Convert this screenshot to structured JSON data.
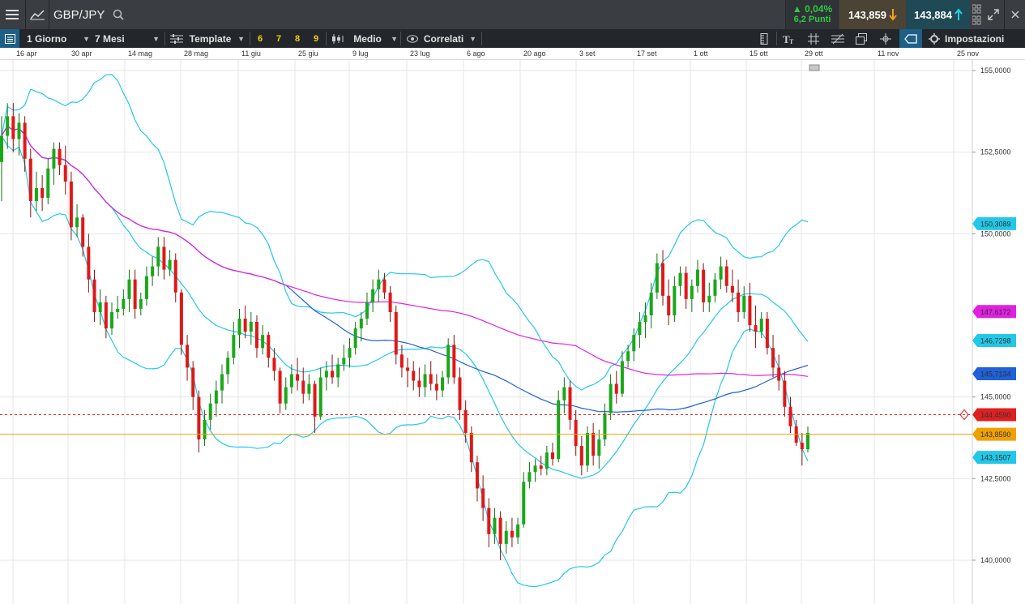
{
  "header": {
    "menu_icon": "hamburger-icon",
    "chart_icon": "line-chart-icon",
    "symbol": "GBP/JPY",
    "search_icon": "search-icon",
    "change_pct": "▲ 0,04%",
    "change_points": "6,2 Punti",
    "sell_price": "143,859",
    "buy_price": "143,884",
    "colors": {
      "up": "#2ecc40",
      "sell_bg": "#4b4333",
      "buy_bg": "#1f4a55",
      "arrow_sell": "#f0a020",
      "arrow_buy": "#28c8e8"
    }
  },
  "toolbar": {
    "interval": "1 Giorno",
    "range": "7 Mesi",
    "template": "Template",
    "presets": [
      "6",
      "7",
      "8",
      "9"
    ],
    "style": "Medio",
    "correlated": "Correlati",
    "settings": "Impostazioni"
  },
  "dates": [
    "16 apr",
    "30 apr",
    "14 mag",
    "28 mag",
    "11 giu",
    "25 giu",
    "9 lug",
    "23 lug",
    "6 ago",
    "20 ago",
    "3 set",
    "17 set",
    "1 ott",
    "15 ott",
    "29 ott",
    "11 nov",
    "25 nov"
  ],
  "chart_data": {
    "type": "candlestick",
    "symbol": "GBP/JPY",
    "y_ticks": [
      "155,0000",
      "152,5000",
      "150,0000",
      "145,0000",
      "142,5000",
      "140,0000"
    ],
    "ylim": [
      139.2,
      155.4
    ],
    "price_labels": [
      {
        "value": "150,3089",
        "series": "bollinger_upper",
        "color": "#22c8e8"
      },
      {
        "value": "147,6172",
        "series": "ma_long",
        "color": "#e020e0"
      },
      {
        "value": "146,7298",
        "series": "bollinger_mid_fast",
        "color": "#22c8e8"
      },
      {
        "value": "145,7134",
        "series": "ma_mid",
        "color": "#2060d8"
      },
      {
        "value": "144,4590",
        "series": "alert_line",
        "color": "#e02020"
      },
      {
        "value": "143,8590",
        "series": "last_price",
        "color": "#f0a000"
      },
      {
        "value": "143,1507",
        "series": "bollinger_lower",
        "color": "#22c8e8"
      }
    ],
    "candles": [
      {
        "o": 152.2,
        "h": 153.6,
        "l": 151.0,
        "c": 153.0
      },
      {
        "o": 153.0,
        "h": 154.0,
        "l": 152.6,
        "c": 153.6
      },
      {
        "o": 153.6,
        "h": 154.0,
        "l": 152.5,
        "c": 152.9
      },
      {
        "o": 152.9,
        "h": 153.7,
        "l": 152.4,
        "c": 153.4
      },
      {
        "o": 153.4,
        "h": 153.6,
        "l": 151.9,
        "c": 152.3
      },
      {
        "o": 152.3,
        "h": 152.6,
        "l": 150.5,
        "c": 151.0
      },
      {
        "o": 151.0,
        "h": 151.9,
        "l": 150.7,
        "c": 151.4
      },
      {
        "o": 151.4,
        "h": 151.8,
        "l": 150.7,
        "c": 151.1
      },
      {
        "o": 151.1,
        "h": 152.3,
        "l": 150.9,
        "c": 152.0
      },
      {
        "o": 152.0,
        "h": 152.8,
        "l": 151.5,
        "c": 152.6
      },
      {
        "o": 152.6,
        "h": 152.8,
        "l": 151.8,
        "c": 152.1
      },
      {
        "o": 152.1,
        "h": 152.7,
        "l": 151.2,
        "c": 151.6
      },
      {
        "o": 151.6,
        "h": 151.9,
        "l": 149.8,
        "c": 150.2
      },
      {
        "o": 150.2,
        "h": 150.9,
        "l": 149.9,
        "c": 150.5
      },
      {
        "o": 150.5,
        "h": 150.6,
        "l": 149.3,
        "c": 149.6
      },
      {
        "o": 149.6,
        "h": 150.0,
        "l": 148.2,
        "c": 148.6
      },
      {
        "o": 148.6,
        "h": 148.9,
        "l": 147.3,
        "c": 147.6
      },
      {
        "o": 147.6,
        "h": 148.3,
        "l": 147.2,
        "c": 147.9
      },
      {
        "o": 147.9,
        "h": 148.1,
        "l": 146.8,
        "c": 147.1
      },
      {
        "o": 147.1,
        "h": 147.9,
        "l": 146.9,
        "c": 147.6
      },
      {
        "o": 147.6,
        "h": 148.1,
        "l": 147.4,
        "c": 147.7
      },
      {
        "o": 147.7,
        "h": 148.3,
        "l": 147.5,
        "c": 148.0
      },
      {
        "o": 148.0,
        "h": 148.9,
        "l": 147.6,
        "c": 148.6
      },
      {
        "o": 148.6,
        "h": 148.9,
        "l": 147.4,
        "c": 147.7
      },
      {
        "o": 147.7,
        "h": 148.2,
        "l": 147.5,
        "c": 148.0
      },
      {
        "o": 148.0,
        "h": 149.0,
        "l": 147.8,
        "c": 148.7
      },
      {
        "o": 148.7,
        "h": 149.3,
        "l": 148.4,
        "c": 149.0
      },
      {
        "o": 149.0,
        "h": 149.9,
        "l": 148.7,
        "c": 149.6
      },
      {
        "o": 149.6,
        "h": 149.9,
        "l": 148.6,
        "c": 148.9
      },
      {
        "o": 148.9,
        "h": 149.5,
        "l": 148.7,
        "c": 149.2
      },
      {
        "o": 149.2,
        "h": 149.4,
        "l": 147.9,
        "c": 148.2
      },
      {
        "o": 148.2,
        "h": 148.3,
        "l": 146.3,
        "c": 146.6
      },
      {
        "o": 146.6,
        "h": 146.9,
        "l": 145.5,
        "c": 145.9
      },
      {
        "o": 145.9,
        "h": 146.1,
        "l": 144.6,
        "c": 145.0
      },
      {
        "o": 145.0,
        "h": 145.2,
        "l": 143.3,
        "c": 143.7
      },
      {
        "o": 143.7,
        "h": 144.6,
        "l": 143.5,
        "c": 144.3
      },
      {
        "o": 144.3,
        "h": 145.1,
        "l": 144.0,
        "c": 144.8
      },
      {
        "o": 144.8,
        "h": 145.5,
        "l": 144.4,
        "c": 145.2
      },
      {
        "o": 145.2,
        "h": 146.0,
        "l": 144.8,
        "c": 145.7
      },
      {
        "o": 145.7,
        "h": 146.4,
        "l": 145.4,
        "c": 146.2
      },
      {
        "o": 146.2,
        "h": 147.3,
        "l": 146.0,
        "c": 146.9
      },
      {
        "o": 146.9,
        "h": 147.7,
        "l": 146.5,
        "c": 147.4
      },
      {
        "o": 147.4,
        "h": 147.8,
        "l": 146.8,
        "c": 147.0
      },
      {
        "o": 147.0,
        "h": 147.6,
        "l": 146.6,
        "c": 147.3
      },
      {
        "o": 147.3,
        "h": 147.5,
        "l": 146.2,
        "c": 146.5
      },
      {
        "o": 146.5,
        "h": 147.2,
        "l": 146.3,
        "c": 146.9
      },
      {
        "o": 146.9,
        "h": 147.0,
        "l": 145.9,
        "c": 146.2
      },
      {
        "o": 146.2,
        "h": 146.5,
        "l": 145.5,
        "c": 145.8
      },
      {
        "o": 145.8,
        "h": 145.9,
        "l": 144.5,
        "c": 144.8
      },
      {
        "o": 144.8,
        "h": 145.6,
        "l": 144.6,
        "c": 145.3
      },
      {
        "o": 145.3,
        "h": 146.0,
        "l": 145.1,
        "c": 145.7
      },
      {
        "o": 145.7,
        "h": 146.2,
        "l": 145.2,
        "c": 145.5
      },
      {
        "o": 145.5,
        "h": 145.9,
        "l": 144.8,
        "c": 145.1
      },
      {
        "o": 145.1,
        "h": 145.7,
        "l": 144.9,
        "c": 145.4
      },
      {
        "o": 145.4,
        "h": 145.5,
        "l": 143.9,
        "c": 144.4
      },
      {
        "o": 144.4,
        "h": 145.9,
        "l": 144.3,
        "c": 145.6
      },
      {
        "o": 145.6,
        "h": 146.1,
        "l": 145.2,
        "c": 145.8
      },
      {
        "o": 145.8,
        "h": 146.3,
        "l": 145.4,
        "c": 145.6
      },
      {
        "o": 145.6,
        "h": 146.2,
        "l": 145.3,
        "c": 146.0
      },
      {
        "o": 146.0,
        "h": 146.6,
        "l": 145.8,
        "c": 146.2
      },
      {
        "o": 146.2,
        "h": 146.8,
        "l": 145.9,
        "c": 146.5
      },
      {
        "o": 146.5,
        "h": 147.3,
        "l": 146.3,
        "c": 147.1
      },
      {
        "o": 147.1,
        "h": 147.6,
        "l": 146.7,
        "c": 147.4
      },
      {
        "o": 147.4,
        "h": 148.2,
        "l": 147.2,
        "c": 147.9
      },
      {
        "o": 147.9,
        "h": 148.6,
        "l": 147.6,
        "c": 148.3
      },
      {
        "o": 148.3,
        "h": 148.9,
        "l": 147.9,
        "c": 148.6
      },
      {
        "o": 148.6,
        "h": 148.8,
        "l": 148.0,
        "c": 148.2
      },
      {
        "o": 148.2,
        "h": 148.4,
        "l": 147.3,
        "c": 147.6
      },
      {
        "o": 147.6,
        "h": 147.8,
        "l": 146.0,
        "c": 146.3
      },
      {
        "o": 146.3,
        "h": 146.6,
        "l": 145.6,
        "c": 145.9
      },
      {
        "o": 145.9,
        "h": 146.2,
        "l": 145.3,
        "c": 145.8
      },
      {
        "o": 145.8,
        "h": 146.1,
        "l": 145.2,
        "c": 145.5
      },
      {
        "o": 145.5,
        "h": 145.9,
        "l": 145.0,
        "c": 145.3
      },
      {
        "o": 145.3,
        "h": 146.0,
        "l": 145.0,
        "c": 145.7
      },
      {
        "o": 145.7,
        "h": 146.1,
        "l": 145.2,
        "c": 145.4
      },
      {
        "o": 145.4,
        "h": 145.7,
        "l": 144.9,
        "c": 145.2
      },
      {
        "o": 145.2,
        "h": 145.8,
        "l": 145.0,
        "c": 145.6
      },
      {
        "o": 145.6,
        "h": 146.8,
        "l": 145.4,
        "c": 146.6
      },
      {
        "o": 146.6,
        "h": 146.9,
        "l": 145.4,
        "c": 145.6
      },
      {
        "o": 145.6,
        "h": 145.9,
        "l": 144.3,
        "c": 144.6
      },
      {
        "o": 144.6,
        "h": 144.9,
        "l": 143.6,
        "c": 143.9
      },
      {
        "o": 143.9,
        "h": 144.1,
        "l": 142.7,
        "c": 143.0
      },
      {
        "o": 143.0,
        "h": 143.2,
        "l": 141.8,
        "c": 142.2
      },
      {
        "o": 142.2,
        "h": 142.6,
        "l": 141.2,
        "c": 141.6
      },
      {
        "o": 141.6,
        "h": 141.9,
        "l": 140.4,
        "c": 140.8
      },
      {
        "o": 140.8,
        "h": 141.6,
        "l": 140.5,
        "c": 141.3
      },
      {
        "o": 141.3,
        "h": 141.5,
        "l": 140.0,
        "c": 140.5
      },
      {
        "o": 140.5,
        "h": 141.2,
        "l": 140.2,
        "c": 140.9
      },
      {
        "o": 140.9,
        "h": 141.3,
        "l": 140.4,
        "c": 140.7
      },
      {
        "o": 140.7,
        "h": 141.3,
        "l": 140.5,
        "c": 141.1
      },
      {
        "o": 141.1,
        "h": 142.7,
        "l": 141.0,
        "c": 142.4
      },
      {
        "o": 142.4,
        "h": 143.0,
        "l": 142.2,
        "c": 142.7
      },
      {
        "o": 142.7,
        "h": 143.1,
        "l": 142.4,
        "c": 142.9
      },
      {
        "o": 142.9,
        "h": 143.2,
        "l": 142.6,
        "c": 142.8
      },
      {
        "o": 142.8,
        "h": 143.5,
        "l": 142.6,
        "c": 143.3
      },
      {
        "o": 143.3,
        "h": 143.6,
        "l": 142.9,
        "c": 143.1
      },
      {
        "o": 143.1,
        "h": 145.2,
        "l": 143.0,
        "c": 144.9
      },
      {
        "o": 144.9,
        "h": 145.6,
        "l": 144.5,
        "c": 145.3
      },
      {
        "o": 145.3,
        "h": 145.5,
        "l": 144.0,
        "c": 144.3
      },
      {
        "o": 144.3,
        "h": 144.6,
        "l": 143.2,
        "c": 143.5
      },
      {
        "o": 143.5,
        "h": 143.8,
        "l": 142.6,
        "c": 142.9
      },
      {
        "o": 142.9,
        "h": 144.1,
        "l": 142.7,
        "c": 143.9
      },
      {
        "o": 143.9,
        "h": 144.2,
        "l": 142.9,
        "c": 143.2
      },
      {
        "o": 143.2,
        "h": 144.0,
        "l": 142.8,
        "c": 143.7
      },
      {
        "o": 143.7,
        "h": 144.8,
        "l": 143.5,
        "c": 144.5
      },
      {
        "o": 144.5,
        "h": 145.7,
        "l": 144.3,
        "c": 145.4
      },
      {
        "o": 145.4,
        "h": 145.8,
        "l": 144.8,
        "c": 145.1
      },
      {
        "o": 145.1,
        "h": 146.4,
        "l": 145.0,
        "c": 146.1
      },
      {
        "o": 146.1,
        "h": 146.6,
        "l": 145.9,
        "c": 146.4
      },
      {
        "o": 146.4,
        "h": 147.1,
        "l": 146.1,
        "c": 146.9
      },
      {
        "o": 146.9,
        "h": 147.6,
        "l": 146.5,
        "c": 147.3
      },
      {
        "o": 147.3,
        "h": 147.9,
        "l": 146.8,
        "c": 147.5
      },
      {
        "o": 147.5,
        "h": 148.5,
        "l": 147.1,
        "c": 148.2
      },
      {
        "o": 148.2,
        "h": 149.4,
        "l": 148.0,
        "c": 149.1
      },
      {
        "o": 149.1,
        "h": 149.5,
        "l": 147.8,
        "c": 148.1
      },
      {
        "o": 148.1,
        "h": 148.6,
        "l": 147.2,
        "c": 147.5
      },
      {
        "o": 147.5,
        "h": 148.7,
        "l": 147.3,
        "c": 148.4
      },
      {
        "o": 148.4,
        "h": 149.0,
        "l": 148.1,
        "c": 148.8
      },
      {
        "o": 148.8,
        "h": 149.0,
        "l": 147.7,
        "c": 148.0
      },
      {
        "o": 148.0,
        "h": 148.6,
        "l": 147.6,
        "c": 148.4
      },
      {
        "o": 148.4,
        "h": 149.2,
        "l": 148.2,
        "c": 148.9
      },
      {
        "o": 148.9,
        "h": 149.1,
        "l": 147.6,
        "c": 147.9
      },
      {
        "o": 147.9,
        "h": 148.5,
        "l": 147.6,
        "c": 148.1
      },
      {
        "o": 148.1,
        "h": 148.8,
        "l": 147.9,
        "c": 148.6
      },
      {
        "o": 148.6,
        "h": 149.3,
        "l": 148.3,
        "c": 149.0
      },
      {
        "o": 149.0,
        "h": 149.2,
        "l": 148.2,
        "c": 148.4
      },
      {
        "o": 148.4,
        "h": 148.9,
        "l": 147.9,
        "c": 148.2
      },
      {
        "o": 148.2,
        "h": 148.6,
        "l": 147.3,
        "c": 147.6
      },
      {
        "o": 147.6,
        "h": 148.4,
        "l": 147.4,
        "c": 148.1
      },
      {
        "o": 148.1,
        "h": 148.5,
        "l": 147.0,
        "c": 147.2
      },
      {
        "o": 147.2,
        "h": 147.8,
        "l": 146.5,
        "c": 147.0
      },
      {
        "o": 147.0,
        "h": 147.6,
        "l": 146.8,
        "c": 147.4
      },
      {
        "o": 147.4,
        "h": 147.6,
        "l": 146.3,
        "c": 146.5
      },
      {
        "o": 146.5,
        "h": 146.9,
        "l": 145.6,
        "c": 145.9
      },
      {
        "o": 145.9,
        "h": 146.3,
        "l": 145.2,
        "c": 145.5
      },
      {
        "o": 145.5,
        "h": 145.8,
        "l": 144.4,
        "c": 144.7
      },
      {
        "o": 144.7,
        "h": 145.0,
        "l": 143.9,
        "c": 144.1
      },
      {
        "o": 144.1,
        "h": 144.3,
        "l": 143.5,
        "c": 143.6
      },
      {
        "o": 143.6,
        "h": 143.9,
        "l": 142.9,
        "c": 143.4
      },
      {
        "o": 143.4,
        "h": 144.1,
        "l": 143.3,
        "c": 143.9
      }
    ]
  }
}
